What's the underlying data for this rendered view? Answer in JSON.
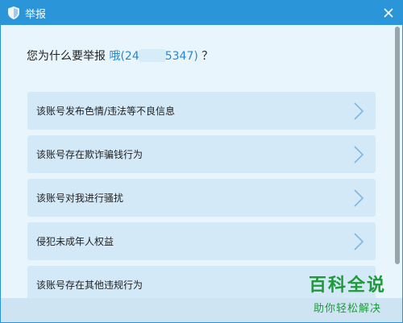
{
  "window": {
    "title": "举报"
  },
  "question": {
    "prefix": "您为什么要举报 ",
    "uid_start": "哦(24",
    "uid_end": "5347)",
    "suffix": " ？"
  },
  "reasons": [
    {
      "label": "该账号发布色情/违法等不良信息"
    },
    {
      "label": "该账号存在欺诈骗钱行为"
    },
    {
      "label": "该账号对我进行骚扰"
    },
    {
      "label": "侵犯未成年人权益"
    },
    {
      "label": "该账号存在其他违规行为"
    }
  ],
  "watermark": {
    "top": "百科全说",
    "bottom": "助你轻松解决"
  },
  "colors": {
    "titlebar": "#2b95d9",
    "accent": "#2a86d0",
    "item_bg": "#d3e9f8",
    "watermark": "#1e9a3a"
  }
}
